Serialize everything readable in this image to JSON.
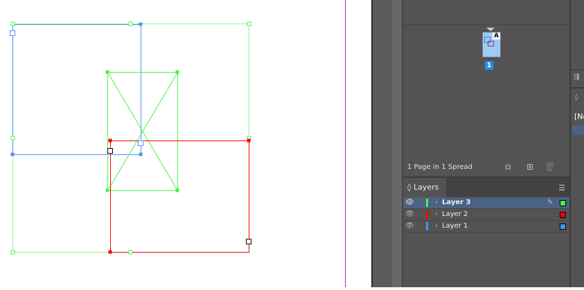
{
  "pages_panel": {
    "status": "1 Page in 1 Spread",
    "page_number": "1",
    "master_letter": "A"
  },
  "layers_panel": {
    "title": "Layers",
    "layers": [
      {
        "name": "Layer 3",
        "color": "#4cf04c",
        "selected": true
      },
      {
        "name": "Layer 2",
        "color": "#ff0000",
        "selected": false
      },
      {
        "name": "Layer 1",
        "color": "#4f94f0",
        "selected": false
      }
    ]
  },
  "right_panel": {
    "text": "[No"
  },
  "colors": {
    "margin_guide": "#a020f0",
    "blue": "#4f94f0",
    "green": "#4cf04c",
    "red": "#ff0000"
  }
}
